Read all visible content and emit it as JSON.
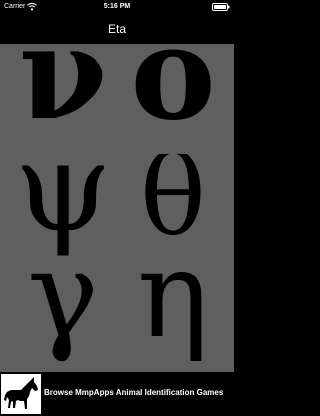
{
  "status_bar": {
    "carrier": "Carrier",
    "time": "5:16 PM"
  },
  "navigation": {
    "title": "Eta"
  },
  "letter_choices": [
    {
      "glyph": "ν",
      "weight": "bold"
    },
    {
      "glyph": "ο",
      "weight": "bold"
    },
    {
      "glyph": "ψ",
      "weight": "normal"
    },
    {
      "glyph": "θ",
      "weight": "normal"
    },
    {
      "glyph": "γ",
      "weight": "normal"
    },
    {
      "glyph": "η",
      "weight": "normal"
    }
  ],
  "ad_banner": {
    "text": "Browse MmpApps Animal Identification Games",
    "icon": "horse-icon"
  },
  "colors": {
    "background": "#5f5f5f",
    "bars": "#000000",
    "letters": "#000000",
    "text": "#ffffff"
  }
}
